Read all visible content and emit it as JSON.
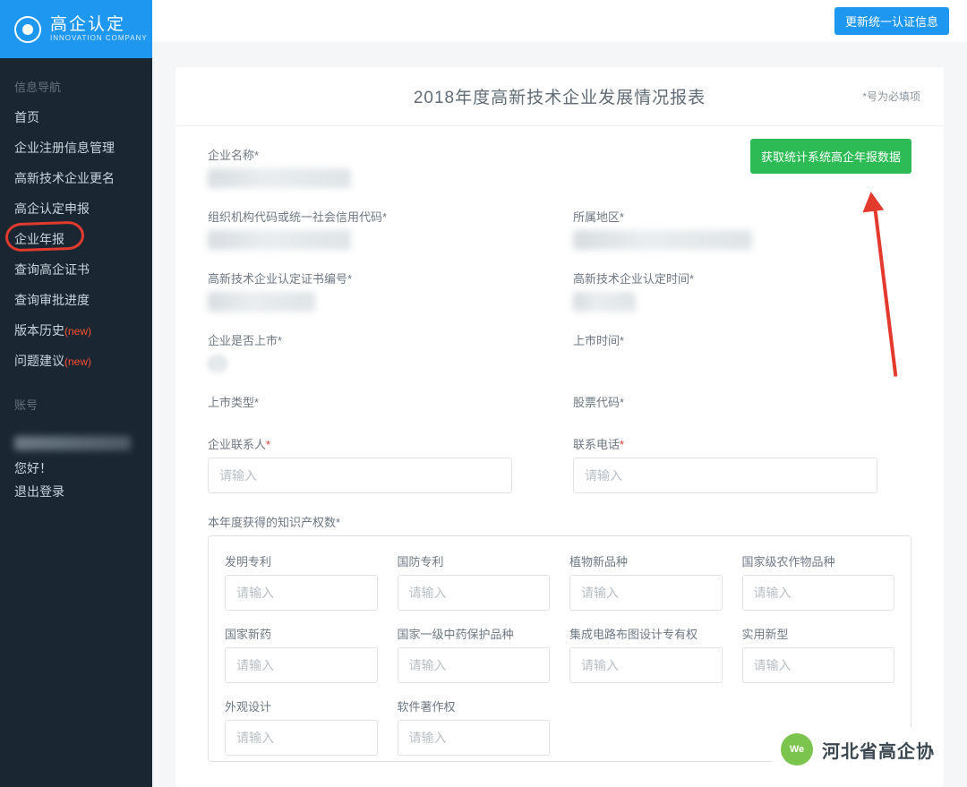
{
  "brand": {
    "title": "高企认定",
    "subtitle": "INNOVATION COMPANY"
  },
  "topbar": {
    "update_auth_label": "更新统一认证信息"
  },
  "sidebar": {
    "group1_title": "信息导航",
    "items": [
      {
        "label": "首页"
      },
      {
        "label": "企业注册信息管理"
      },
      {
        "label": "高新技术企业更名"
      },
      {
        "label": "高企认定申报"
      },
      {
        "label": "企业年报",
        "highlighted": true
      },
      {
        "label": "查询高企证书"
      },
      {
        "label": "查询审批进度"
      },
      {
        "label": "版本历史",
        "tag": "(new)"
      },
      {
        "label": "问题建议",
        "tag": "(new)"
      }
    ],
    "group2_title": "账号",
    "greeting": "您好！",
    "logout": "退出登录"
  },
  "page": {
    "title": "2018年度高新技术企业发展情况报表",
    "required_note": "*号为必填项",
    "fetch_button": "获取统计系统高企年报数据"
  },
  "fields": {
    "company_name": "企业名称*",
    "org_code": "组织机构代码或统一社会信用代码*",
    "region": "所属地区*",
    "cert_no": "高新技术企业认定证书编号*",
    "cert_time": "高新技术企业认定时间*",
    "is_listed": "企业是否上市*",
    "list_time": "上市时间*",
    "list_type": "上市类型*",
    "stock_code": "股票代码*",
    "contact_person": "企业联系人*",
    "contact_phone": "联系电话*",
    "ip_section": "本年度获得的知识产权数*",
    "placeholder": "请输入"
  },
  "ip_items": [
    "发明专利",
    "国防专利",
    "植物新品种",
    "国家级农作物品种",
    "国家新药",
    "国家一级中药保护品种",
    "集成电路布图设计专有权",
    "实用新型",
    "外观设计",
    "软件著作权"
  ],
  "watermark": {
    "text": "河北省高企协"
  }
}
